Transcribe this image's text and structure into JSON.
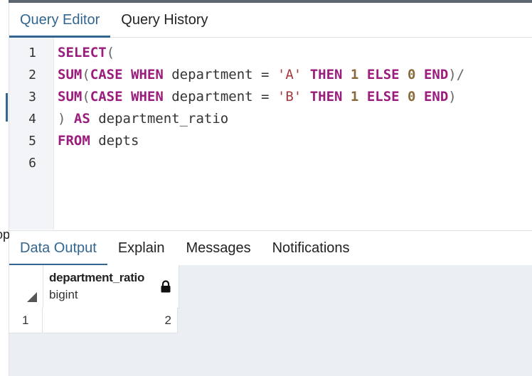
{
  "left_panel": {
    "clipped_text": "op"
  },
  "editor_tabs": [
    {
      "label": "Query Editor",
      "active": true
    },
    {
      "label": "Query History",
      "active": false
    }
  ],
  "editor": {
    "line_numbers": [
      "1",
      "2",
      "3",
      "4",
      "5",
      "6"
    ],
    "lines": [
      [
        {
          "t": "SELECT",
          "c": "kw"
        },
        {
          "t": "(",
          "c": "punc"
        }
      ],
      [
        {
          "t": "SUM",
          "c": "kw"
        },
        {
          "t": "(",
          "c": "punc"
        },
        {
          "t": "CASE",
          "c": "kw"
        },
        {
          "t": " ",
          "c": "id"
        },
        {
          "t": "WHEN",
          "c": "kw"
        },
        {
          "t": " department = ",
          "c": "id"
        },
        {
          "t": "'A'",
          "c": "str"
        },
        {
          "t": " ",
          "c": "id"
        },
        {
          "t": "THEN",
          "c": "kw"
        },
        {
          "t": " ",
          "c": "id"
        },
        {
          "t": "1",
          "c": "num"
        },
        {
          "t": " ",
          "c": "id"
        },
        {
          "t": "ELSE",
          "c": "kw"
        },
        {
          "t": " ",
          "c": "id"
        },
        {
          "t": "0",
          "c": "num"
        },
        {
          "t": " ",
          "c": "id"
        },
        {
          "t": "END",
          "c": "kw"
        },
        {
          "t": ")/",
          "c": "punc"
        }
      ],
      [
        {
          "t": "SUM",
          "c": "kw"
        },
        {
          "t": "(",
          "c": "punc"
        },
        {
          "t": "CASE",
          "c": "kw"
        },
        {
          "t": " ",
          "c": "id"
        },
        {
          "t": "WHEN",
          "c": "kw"
        },
        {
          "t": " department = ",
          "c": "id"
        },
        {
          "t": "'B'",
          "c": "str"
        },
        {
          "t": " ",
          "c": "id"
        },
        {
          "t": "THEN",
          "c": "kw"
        },
        {
          "t": " ",
          "c": "id"
        },
        {
          "t": "1",
          "c": "num"
        },
        {
          "t": " ",
          "c": "id"
        },
        {
          "t": "ELSE",
          "c": "kw"
        },
        {
          "t": " ",
          "c": "id"
        },
        {
          "t": "0",
          "c": "num"
        },
        {
          "t": " ",
          "c": "id"
        },
        {
          "t": "END",
          "c": "kw"
        },
        {
          "t": ")",
          "c": "punc"
        }
      ],
      [
        {
          "t": ") ",
          "c": "punc"
        },
        {
          "t": "AS",
          "c": "kw"
        },
        {
          "t": " department_ratio",
          "c": "id"
        }
      ],
      [
        {
          "t": "FROM",
          "c": "kw"
        },
        {
          "t": " depts",
          "c": "id"
        }
      ],
      []
    ]
  },
  "output_tabs": [
    {
      "label": "Data Output",
      "active": true
    },
    {
      "label": "Explain",
      "active": false
    },
    {
      "label": "Messages",
      "active": false
    },
    {
      "label": "Notifications",
      "active": false
    }
  ],
  "result_grid": {
    "columns": [
      {
        "name": "department_ratio",
        "type": "bigint",
        "icon": "lock-icon"
      }
    ],
    "rows": [
      {
        "row_number": "1",
        "cells": [
          "2"
        ]
      }
    ]
  },
  "colors": {
    "accent": "#326690",
    "keyword": "#9b1c7c",
    "string": "#a6393d",
    "number": "#8a6a3a"
  }
}
